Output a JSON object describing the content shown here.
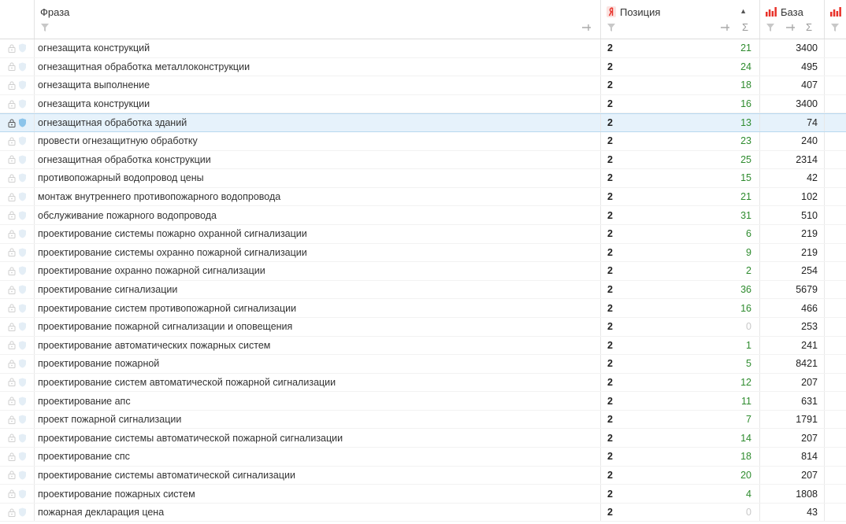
{
  "header": {
    "phrase_label": "Фраза",
    "position_label": "Позиция",
    "base_label": "База",
    "sort_indicator": "▲",
    "sum_symbol": "Σ"
  },
  "colors": {
    "positive_position": "#2e8b2e",
    "zero_position": "#c8c8c8",
    "selected_row": "#e6f2fb",
    "yandex_red": "#e8322a"
  },
  "rows": [
    {
      "phrase": "огнезащита конструкций",
      "freq": "2",
      "position": "21",
      "base": "3400"
    },
    {
      "phrase": "огнезащитная обработка металлоконструкции",
      "freq": "2",
      "position": "24",
      "base": "495"
    },
    {
      "phrase": "огнезащита выполнение",
      "freq": "2",
      "position": "18",
      "base": "407"
    },
    {
      "phrase": "огнезащита конструкции",
      "freq": "2",
      "position": "16",
      "base": "3400"
    },
    {
      "phrase": "огнезащитная обработка зданий",
      "freq": "2",
      "position": "13",
      "base": "74",
      "selected": true
    },
    {
      "phrase": "провести огнезащитную обработку",
      "freq": "2",
      "position": "23",
      "base": "240"
    },
    {
      "phrase": "огнезащитная обработка конструкции",
      "freq": "2",
      "position": "25",
      "base": "2314"
    },
    {
      "phrase": "противопожарный водопровод цены",
      "freq": "2",
      "position": "15",
      "base": "42"
    },
    {
      "phrase": "монтаж внутреннего противопожарного водопровода",
      "freq": "2",
      "position": "21",
      "base": "102"
    },
    {
      "phrase": "обслуживание пожарного водопровода",
      "freq": "2",
      "position": "31",
      "base": "510"
    },
    {
      "phrase": "проектирование системы пожарно охранной сигнализации",
      "freq": "2",
      "position": "6",
      "base": "219"
    },
    {
      "phrase": "проектирование системы охранно пожарной сигнализации",
      "freq": "2",
      "position": "9",
      "base": "219"
    },
    {
      "phrase": "проектирование охранно пожарной сигнализации",
      "freq": "2",
      "position": "2",
      "base": "254"
    },
    {
      "phrase": "проектирование сигнализации",
      "freq": "2",
      "position": "36",
      "base": "5679"
    },
    {
      "phrase": "проектирование систем противопожарной сигнализации",
      "freq": "2",
      "position": "16",
      "base": "466"
    },
    {
      "phrase": "проектирование пожарной сигнализации и оповещения",
      "freq": "2",
      "position": "0",
      "base": "253"
    },
    {
      "phrase": "проектирование автоматических пожарных систем",
      "freq": "2",
      "position": "1",
      "base": "241"
    },
    {
      "phrase": "проектирование пожарной",
      "freq": "2",
      "position": "5",
      "base": "8421"
    },
    {
      "phrase": "проектирование систем автоматической пожарной сигнализации",
      "freq": "2",
      "position": "12",
      "base": "207"
    },
    {
      "phrase": "проектирование апс",
      "freq": "2",
      "position": "11",
      "base": "631"
    },
    {
      "phrase": "проект пожарной сигнализации",
      "freq": "2",
      "position": "7",
      "base": "1791"
    },
    {
      "phrase": "проектирование системы автоматической пожарной сигнализации",
      "freq": "2",
      "position": "14",
      "base": "207"
    },
    {
      "phrase": "проектирование спс",
      "freq": "2",
      "position": "18",
      "base": "814"
    },
    {
      "phrase": "проектирование системы автоматической сигнализации",
      "freq": "2",
      "position": "20",
      "base": "207"
    },
    {
      "phrase": "проектирование пожарных систем",
      "freq": "2",
      "position": "4",
      "base": "1808"
    },
    {
      "phrase": "пожарная декларация цена",
      "freq": "2",
      "position": "0",
      "base": "43"
    }
  ]
}
